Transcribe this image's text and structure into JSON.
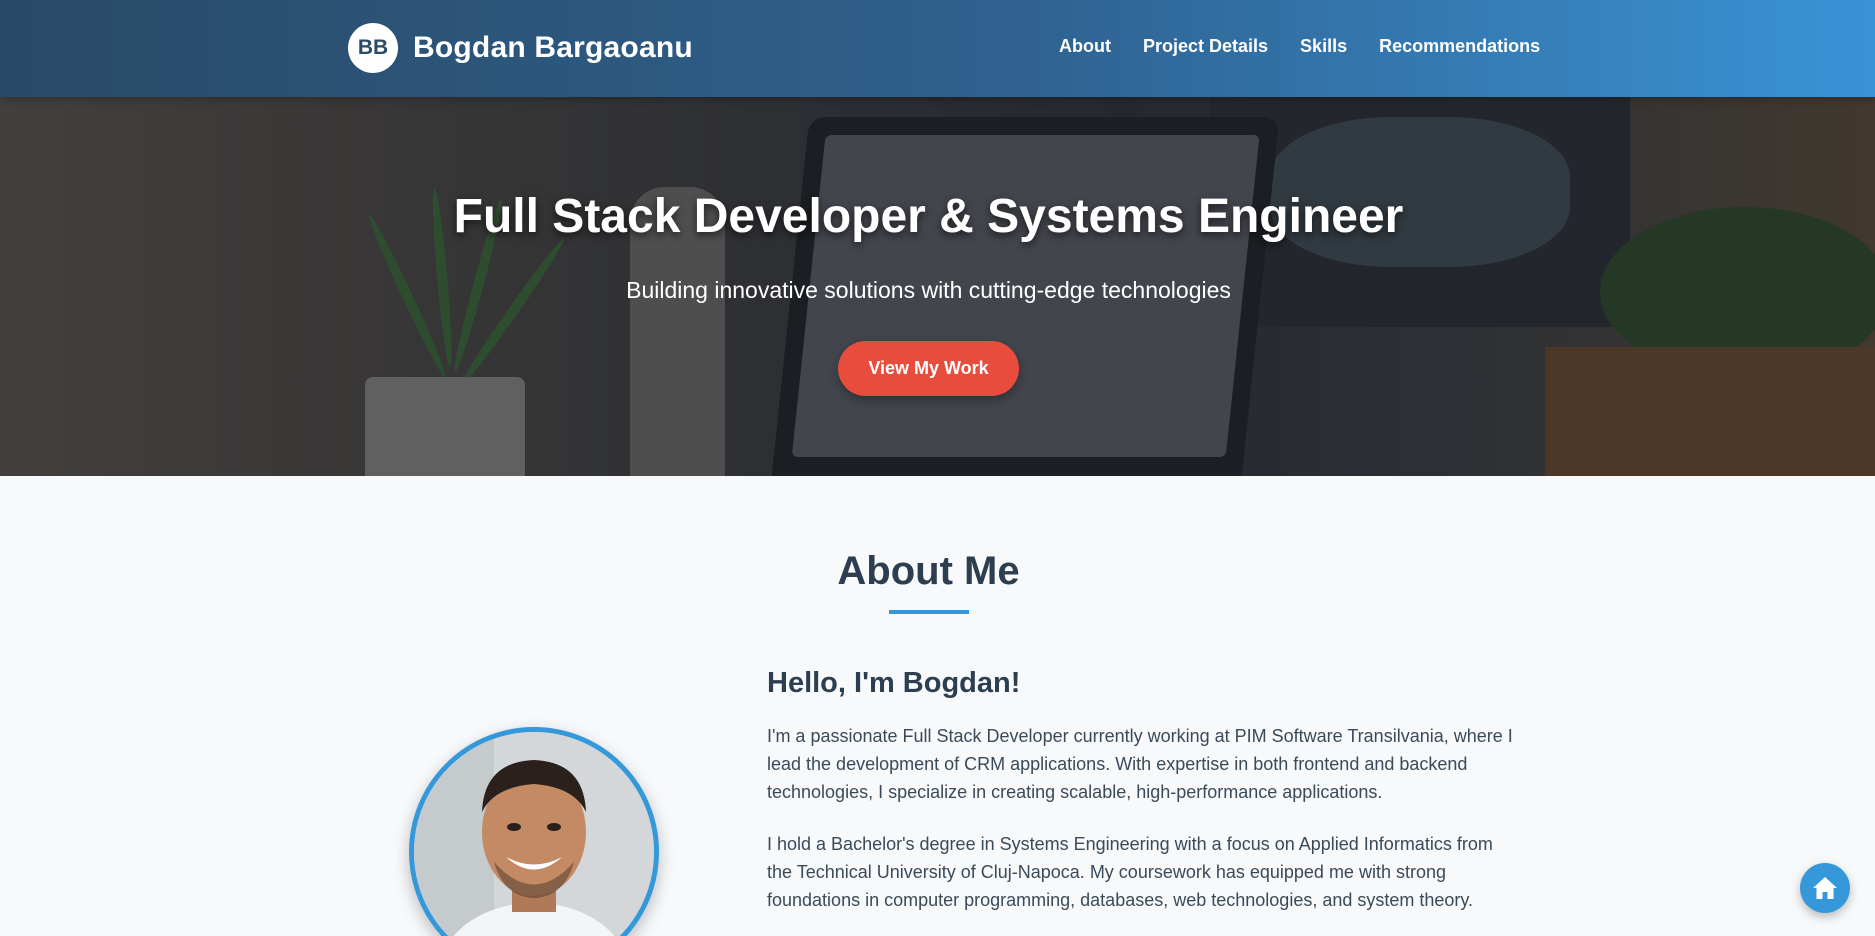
{
  "header": {
    "logo_initials": "BB",
    "brand_name": "Bogdan Bargaoanu",
    "nav": [
      {
        "label": "About"
      },
      {
        "label": "Project Details"
      },
      {
        "label": "Skills"
      },
      {
        "label": "Recommendations"
      }
    ]
  },
  "hero": {
    "title": "Full Stack Developer & Systems Engineer",
    "subtitle": "Building innovative solutions with cutting-edge technologies",
    "cta_label": "View My Work"
  },
  "about": {
    "section_title": "About Me",
    "heading": "Hello, I'm Bogdan!",
    "paragraphs": [
      "I'm a passionate Full Stack Developer currently working at PIM Software Transilvania, where I lead the development of CRM applications. With expertise in both frontend and backend technologies, I specialize in creating scalable, high-performance applications.",
      "I hold a Bachelor's degree in Systems Engineering with a focus on Applied Informatics from the Technical University of Cluj-Napoca. My coursework has equipped me with strong foundations in computer programming, databases, web technologies, and system theory."
    ]
  },
  "colors": {
    "accent": "#3498db",
    "cta": "#e74c3c",
    "heading": "#2c3e50"
  },
  "icons": {
    "floating_button": "home-icon"
  }
}
